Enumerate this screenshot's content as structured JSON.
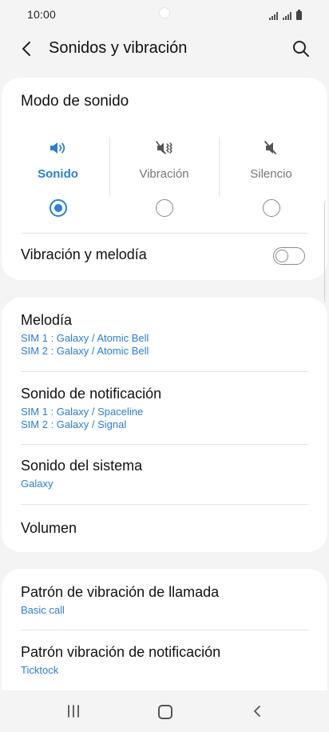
{
  "status": {
    "time": "10:00"
  },
  "header": {
    "title": "Sonidos y vibración"
  },
  "sound_mode": {
    "title": "Modo de sonido",
    "options": [
      {
        "label": "Sonido",
        "icon": "speaker-icon",
        "selected": true
      },
      {
        "label": "Vibración",
        "icon": "vibrate-icon",
        "selected": false
      },
      {
        "label": "Silencio",
        "icon": "mute-icon",
        "selected": false
      }
    ],
    "vibrate_with_ringtone": {
      "label": "Vibración y melodía",
      "on": false
    }
  },
  "ringtones": {
    "melody": {
      "title": "Melodía",
      "sim1": "SIM 1 : Galaxy / Atomic Bell",
      "sim2": "SIM 2 : Galaxy / Atomic Bell"
    },
    "notification": {
      "title": "Sonido de notificación",
      "sim1": "SIM 1 : Galaxy / Spaceline",
      "sim2": "SIM 2 : Galaxy / Signal"
    },
    "system": {
      "title": "Sonido del sistema",
      "value": "Galaxy"
    },
    "volume": {
      "title": "Volumen"
    }
  },
  "vibration": {
    "call_pattern": {
      "title": "Patrón de vibración de llamada",
      "value": "Basic call"
    },
    "notification_pattern": {
      "title": "Patrón vibración de notificación",
      "value": "Ticktock"
    }
  },
  "colors": {
    "accent": "#2b7fd4",
    "background": "#f4f4f4",
    "card": "#ffffff"
  }
}
